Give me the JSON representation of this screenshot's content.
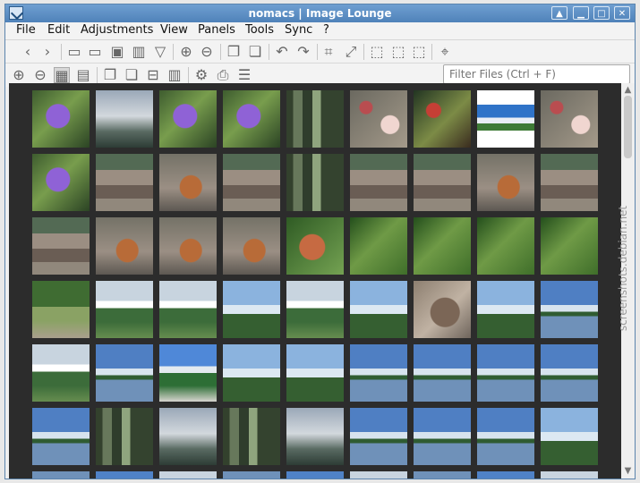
{
  "window": {
    "title": "nomacs | Image Lounge"
  },
  "menu": [
    "File",
    "Edit",
    "Adjustments",
    "View",
    "Panels",
    "Tools",
    "Sync",
    "?"
  ],
  "filter": {
    "placeholder": "Filter Files (Ctrl + F)"
  },
  "watermark": "screenshots.debian.net",
  "thumbnails": [
    [
      "flower",
      "sky",
      "flower",
      "flower",
      "forest",
      "bokeh",
      "berries",
      "landscape",
      "bokeh"
    ],
    [
      "flower",
      "ground",
      "squirrel",
      "ground",
      "forest",
      "ground",
      "ground",
      "squirrel",
      "ground"
    ],
    [
      "ground",
      "squirrel",
      "squirrel",
      "squirrel",
      "leaf",
      "green",
      "green",
      "green",
      "green"
    ],
    [
      "grass",
      "meadow",
      "meadow",
      "pine",
      "meadow",
      "pine",
      "duck",
      "pine",
      "lake"
    ],
    [
      "meadow",
      "lake",
      "beach",
      "pine",
      "pine",
      "lake",
      "lake",
      "lake",
      "lake"
    ],
    [
      "lake",
      "forest",
      "sky",
      "forest",
      "sky",
      "lake",
      "lake",
      "lake",
      "pine"
    ]
  ]
}
